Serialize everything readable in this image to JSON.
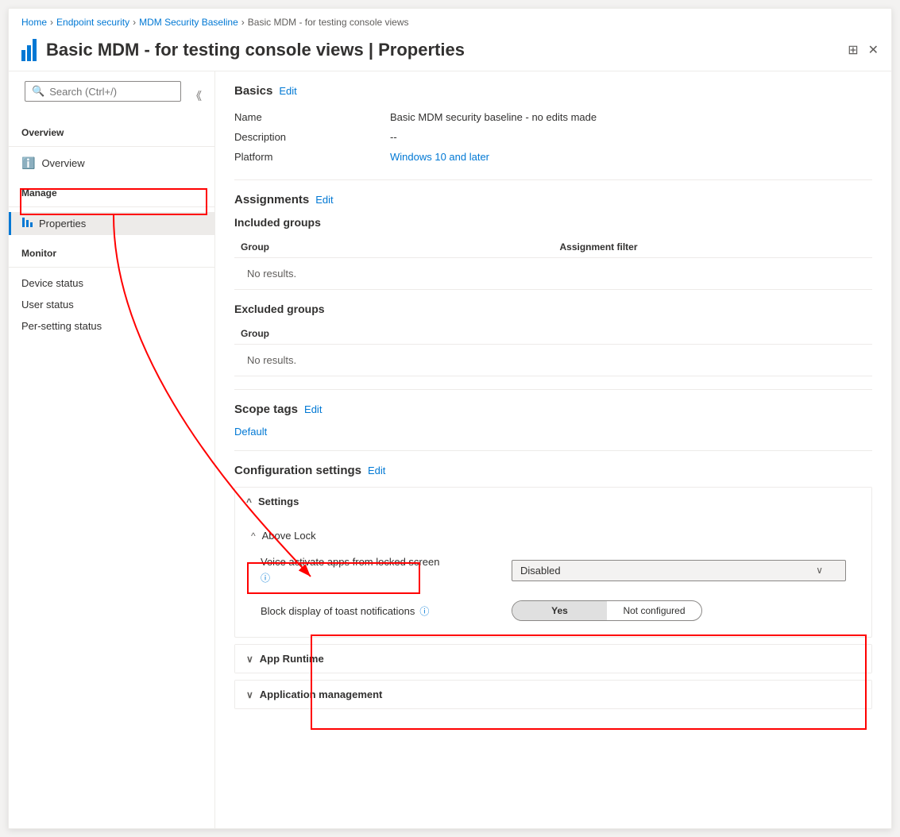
{
  "breadcrumb": {
    "items": [
      "Home",
      "Endpoint security",
      "MDM Security Baseline",
      "Basic MDM - for testing console views"
    ]
  },
  "header": {
    "title": "Basic MDM - for testing console views | Properties"
  },
  "search": {
    "placeholder": "Search (Ctrl+/)"
  },
  "sidebar": {
    "overview_section": "Overview",
    "overview_item": "Overview",
    "manage_section": "Manage",
    "properties_item": "Properties",
    "monitor_section": "Monitor",
    "device_status": "Device status",
    "user_status": "User status",
    "per_setting_status": "Per-setting status"
  },
  "main": {
    "basics_label": "Basics",
    "basics_edit": "Edit",
    "name_label": "Name",
    "name_value": "Basic MDM security baseline - no edits made",
    "description_label": "Description",
    "description_value": "--",
    "platform_label": "Platform",
    "platform_value": "Windows 10 and later",
    "assignments_label": "Assignments",
    "assignments_edit": "Edit",
    "included_groups_label": "Included groups",
    "group_col": "Group",
    "assignment_filter_col": "Assignment filter",
    "included_no_results": "No results.",
    "excluded_groups_label": "Excluded groups",
    "excluded_group_col": "Group",
    "excluded_no_results": "No results.",
    "scope_tags_label": "Scope tags",
    "scope_tags_edit": "Edit",
    "scope_tag_value": "Default",
    "config_settings_label": "Configuration settings",
    "config_settings_edit": "Edit",
    "settings_accordion": "Settings",
    "above_lock_label": "Above Lock",
    "voice_activate_label": "Voice activate apps from locked screen",
    "voice_activate_value": "Disabled",
    "block_display_label": "Block display of toast notifications",
    "toggle_yes": "Yes",
    "toggle_not_configured": "Not configured",
    "app_runtime_label": "App Runtime",
    "app_mgmt_label": "Application management"
  }
}
